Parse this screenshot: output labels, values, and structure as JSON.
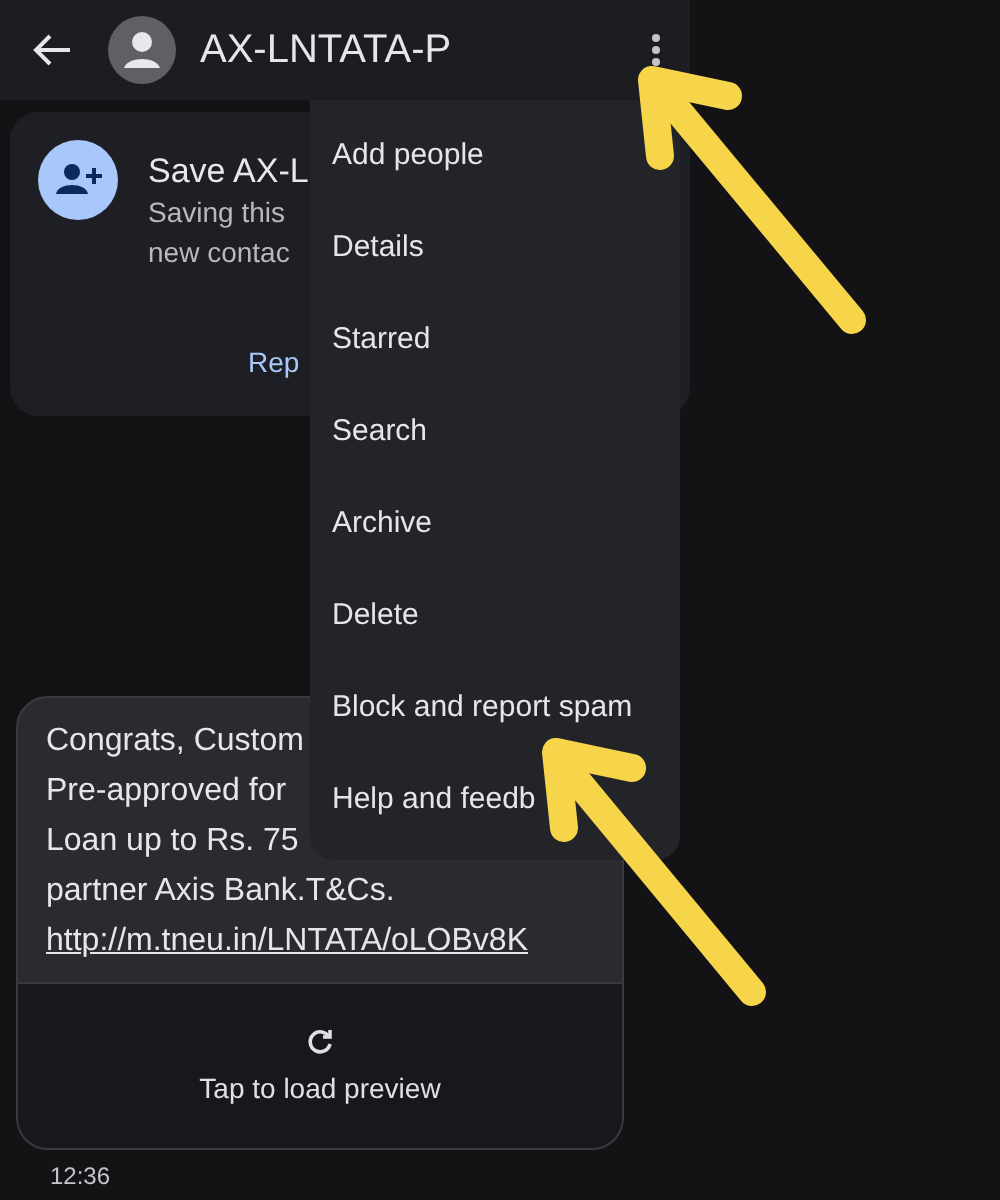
{
  "header": {
    "title": "AX-LNTATA-P"
  },
  "save_card": {
    "title": "Save AX-L",
    "lines": [
      "Saving this",
      "new contac"
    ],
    "action": "Rep"
  },
  "message": {
    "lines": [
      "Congrats, Custom",
      "Pre-approved for",
      "Loan up to Rs. 75",
      "partner Axis Bank.T&Cs."
    ],
    "link": "http://m.tneu.in/LNTATA/oLOBv8K",
    "preview": "Tap to load preview",
    "time": "12:36"
  },
  "menu": {
    "items": [
      {
        "label": "Add people"
      },
      {
        "label": "Details"
      },
      {
        "label": "Starred"
      },
      {
        "label": "Search"
      },
      {
        "label": "Archive"
      },
      {
        "label": "Delete"
      },
      {
        "label": "Block and report spam"
      },
      {
        "label": "Help and feedb"
      }
    ]
  }
}
